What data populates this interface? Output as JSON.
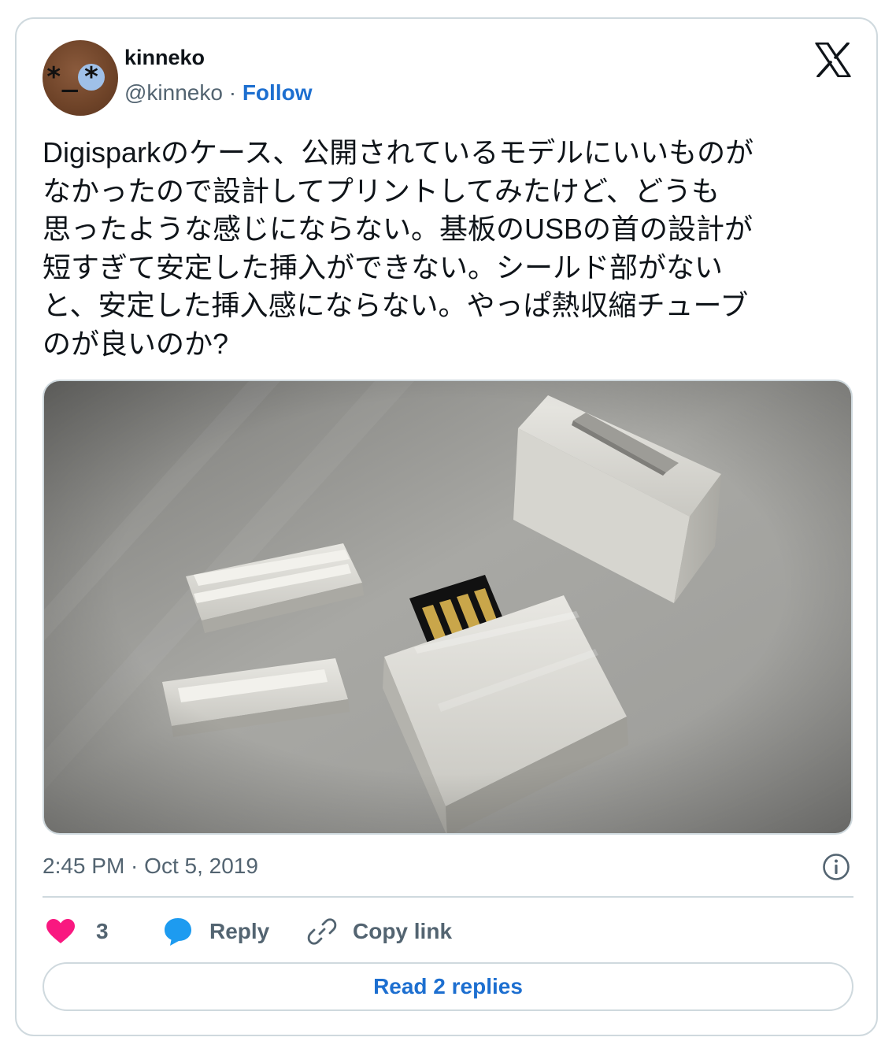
{
  "author": {
    "name": "kinneko",
    "handle": "@kinneko",
    "separator": "·",
    "follow_label": "Follow",
    "avatar_glyphs": {
      "left": "*",
      "mouth": "_",
      "right": "*"
    }
  },
  "platform_icon": "x-logo-icon",
  "tweet": {
    "text": "Digisparkのケース、公開されているモデルにいいものが\nなかったので設計してプリントしてみたけど、どうも\n思ったような感じにならない。基板のUSBの首の設計が\n短すぎて安定した挿入ができない。シールド部がない\nと、安定した挿入感にならない。やっぱ熱収縮チューブ\nのが良いのか?",
    "timestamp": "2:45 PM · Oct 5, 2019"
  },
  "actions": {
    "like_count": "3",
    "reply_label": "Reply",
    "copy_link_label": "Copy link"
  },
  "read_replies_label": "Read 2 replies",
  "colors": {
    "accent": "#1d6fd0",
    "like": "#f91880",
    "reply_bubble": "#1d9bf0",
    "border": "#cfd9de",
    "muted_text": "#536471"
  }
}
